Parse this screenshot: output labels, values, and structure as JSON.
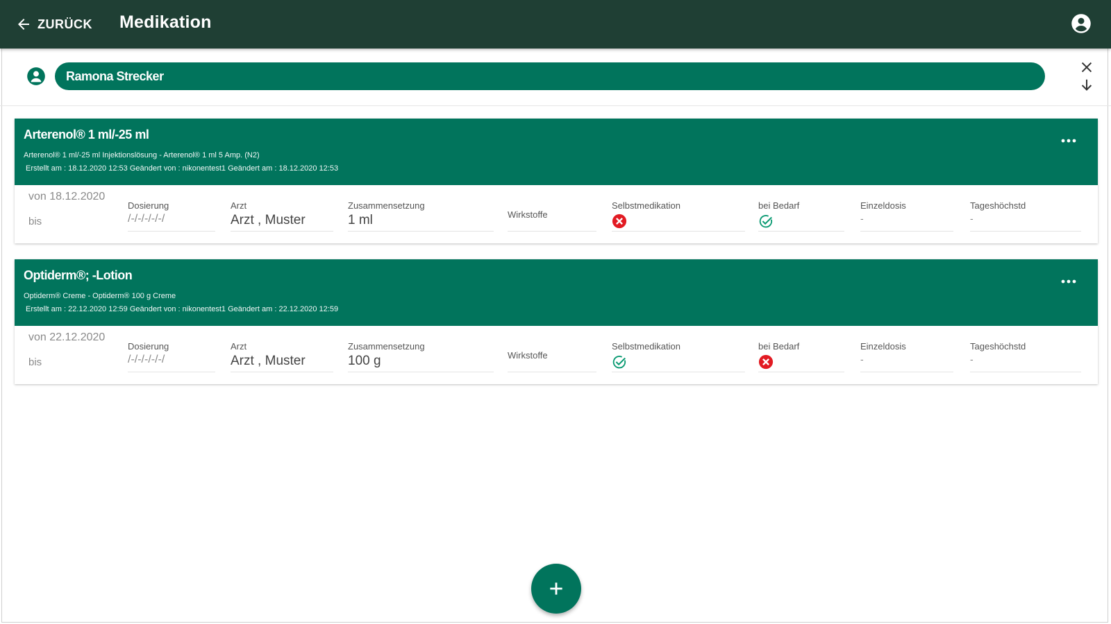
{
  "header": {
    "back_label": "ZURÜCK",
    "title": "Medikation"
  },
  "patient": {
    "name": "Ramona Strecker"
  },
  "medications": [
    {
      "name": "Arterenol® 1 ml/-25 ml",
      "subtitle": "Arterenol® 1 ml/-25 ml Injektionslösung - Arterenol® 1 ml 5 Amp. (N2)",
      "meta": "Erstellt am : 18.12.2020 12:53   Geändert von : nikonentest1   Geändert am : 18.12.2020 12:53",
      "von": "von 18.12.2020",
      "bis": "bis",
      "fields": {
        "dosierung_label": "Dosierung",
        "dosierung_value": "/-/-/-/-/-/",
        "arzt_label": "Arzt",
        "arzt_value": "Arzt , Muster",
        "zusammensetzung_label": "Zusammensetzung",
        "zusammensetzung_value": "1 ml",
        "wirkstoffe_label": "Wirkstoffe",
        "selbstmedikation_label": "Selbstmedikation",
        "selbstmedikation_status": "no",
        "bei_bedarf_label": "bei Bedarf",
        "bei_bedarf_status": "yes",
        "einzeldosis_label": "Einzeldosis",
        "einzeldosis_value": "-",
        "tageshoechstd_label": "Tageshöchstd",
        "tageshoechstd_value": "-"
      }
    },
    {
      "name": "Optiderm®; -Lotion",
      "subtitle": "Optiderm® Creme - Optiderm® 100 g Creme",
      "meta": "Erstellt am : 22.12.2020 12:59   Geändert von : nikonentest1   Geändert am : 22.12.2020 12:59",
      "von": "von 22.12.2020",
      "bis": "bis",
      "fields": {
        "dosierung_label": "Dosierung",
        "dosierung_value": "/-/-/-/-/-/",
        "arzt_label": "Arzt",
        "arzt_value": "Arzt , Muster",
        "zusammensetzung_label": "Zusammensetzung",
        "zusammensetzung_value": "100 g",
        "wirkstoffe_label": "Wirkstoffe",
        "selbstmedikation_label": "Selbstmedikation",
        "selbstmedikation_status": "yes",
        "bei_bedarf_label": "bei Bedarf",
        "bei_bedarf_status": "no",
        "einzeldosis_label": "Einzeldosis",
        "einzeldosis_value": "-",
        "tageshoechstd_label": "Tageshöchstd",
        "tageshoechstd_value": "-"
      }
    }
  ],
  "colors": {
    "appbar": "#1f3f34",
    "primary": "#01745c",
    "check": "#0a9a72",
    "cross": "#e21b23"
  },
  "icons": {
    "back": "arrow-left-icon",
    "account": "account-circle-icon",
    "patient": "person-icon",
    "close": "close-icon",
    "download": "arrow-down-icon",
    "more": "more-horiz-icon",
    "add": "plus-icon",
    "yes": "check-circle-icon",
    "no": "cancel-circle-icon"
  }
}
